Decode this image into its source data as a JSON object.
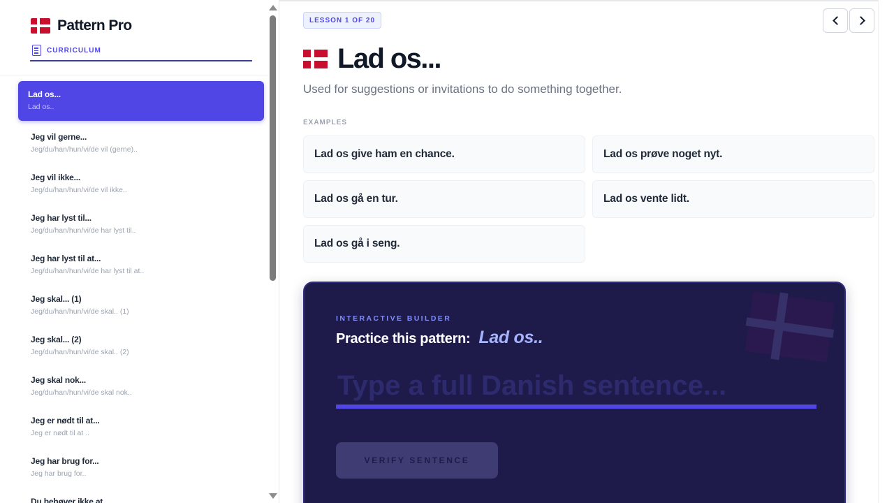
{
  "app": {
    "brand_name": "Pattern Pro",
    "curriculum_tab_label": "CURRICULUM"
  },
  "sidebar": {
    "patterns": [
      {
        "title": "Lad os...",
        "subtitle": "Lad os..",
        "active": true
      },
      {
        "title": "Jeg vil gerne...",
        "subtitle": "Jeg/du/han/hun/vi/de vil (gerne).."
      },
      {
        "title": "Jeg vil ikke...",
        "subtitle": "Jeg/du/han/hun/vi/de vil ikke.."
      },
      {
        "title": "Jeg har lyst til...",
        "subtitle": "Jeg/du/han/hun/vi/de har lyst til.."
      },
      {
        "title": "Jeg har lyst til at...",
        "subtitle": "Jeg/du/han/hun/vi/de har lyst til at.."
      },
      {
        "title": "Jeg skal... (1)",
        "subtitle": "Jeg/du/han/hun/vi/de skal.. (1)"
      },
      {
        "title": "Jeg skal... (2)",
        "subtitle": "Jeg/du/han/hun/vi/de skal.. (2)"
      },
      {
        "title": "Jeg skal nok...",
        "subtitle": "Jeg/du/han/hun/vi/de skal nok.."
      },
      {
        "title": "Jeg er nødt til at...",
        "subtitle": "Jeg er nødt til at .."
      },
      {
        "title": "Jeg har brug for...",
        "subtitle": "Jeg har brug for.."
      },
      {
        "title": "Du behøver ikke at...",
        "subtitle": ""
      }
    ]
  },
  "lesson": {
    "badge": "LESSON 1 OF 20",
    "title": "Lad os...",
    "description": "Used for suggestions or invitations to do something together.",
    "examples_label": "EXAMPLES",
    "examples": [
      "Lad os give ham en chance.",
      "Lad os prøve noget nyt.",
      "Lad os gå en tur.",
      "Lad os vente lidt.",
      "Lad os gå i seng."
    ]
  },
  "builder": {
    "label": "INTERACTIVE BUILDER",
    "heading": "Practice this pattern:",
    "pattern": "Lad os..",
    "input_placeholder": "Type a full Danish sentence...",
    "input_value": "",
    "verify_label": "VERIFY SENTENCE"
  },
  "icons": {
    "brand": "danish-flag-icon",
    "curriculum": "document-icon",
    "prev": "chevron-left-icon",
    "next": "chevron-right-icon"
  },
  "colors": {
    "accent": "#4f46e5",
    "builder_bg": "#1e1b4b",
    "flag_red": "#c8102e"
  }
}
